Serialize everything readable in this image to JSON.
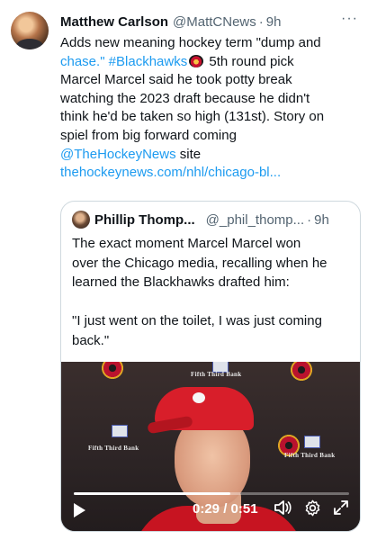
{
  "tweet": {
    "author_name": "Matthew Carlson",
    "author_handle": "@MattCNews",
    "separator": "·",
    "time": "9h",
    "more_label": "···",
    "body": {
      "line1": "Adds new meaning hockey term \"dump and",
      "line2_link": "chase.\" #Blackhawks",
      "line2_text": " 5th round pick",
      "line3": "Marcel Marcel said he took potty break",
      "line4": "watching the 2023 draft because he didn't",
      "line5": "think he'd be taken so high (131st). Story on",
      "line6": "spiel from big  forward coming",
      "mention": "@TheHockeyNews",
      "after_mention": " site",
      "url": "thehockeynews.com/nhl/chicago-bl..."
    }
  },
  "quote": {
    "author_name": "Phillip Thomp...",
    "author_handle": "@_phil_thomp...",
    "separator": "·",
    "time": "9h",
    "lines": [
      "The exact moment Marcel Marcel won",
      "over the Chicago media, recalling when he",
      "learned the Blackhawks drafted him:"
    ],
    "quote_lines": [
      "\"I just went on the toilet, I was just coming",
      "back.\""
    ]
  },
  "video": {
    "sponsor_text": "Fifth Third Bank",
    "current_time": "0:29",
    "time_separator": " / ",
    "duration": "0:51",
    "progress_fraction": 0.57
  },
  "colors": {
    "link": "#1d9bf0",
    "secondary_text": "#536471",
    "border": "#cfd9de"
  }
}
